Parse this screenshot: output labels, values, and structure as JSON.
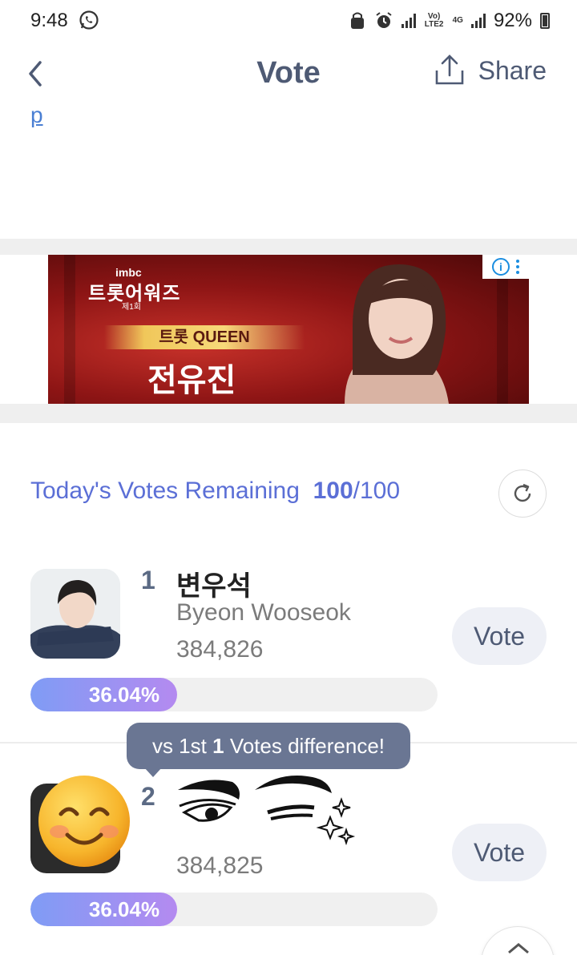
{
  "status_bar": {
    "time": "9:48",
    "lte_label": "Vo) LTE2",
    "net_label": "4G",
    "battery": "92%"
  },
  "header": {
    "title": "Vote",
    "share_label": "Share"
  },
  "partial_link": "p",
  "ad": {
    "logo_top": "imbc",
    "logo": "트롯어워즈",
    "logo_sub": "제1회",
    "banner": "트롯 QUEEN",
    "name": "전유진",
    "info_icon": "info-icon"
  },
  "votes_remaining": {
    "label": "Today's Votes Remaining",
    "current": "100",
    "total": "/100"
  },
  "candidates": [
    {
      "rank": "1",
      "name_ko": "변우석",
      "name_en": "Byeon Wooseok",
      "votes": "384,826",
      "percent_label": "36.04%",
      "percent": 36.04,
      "vote_label": "Vote"
    },
    {
      "rank": "2",
      "votes": "384,825",
      "percent_label": "36.04%",
      "percent": 36.04,
      "vote_label": "Vote"
    }
  ],
  "tooltip": {
    "prefix": "vs 1st",
    "count": "1",
    "suffix": "Votes difference!"
  },
  "colors": {
    "accent": "#5b6fd6",
    "nav_text": "#4e5a74",
    "bar_start": "#7f9cf5",
    "bar_end": "#b48af0",
    "tooltip_bg": "#6a7693"
  }
}
